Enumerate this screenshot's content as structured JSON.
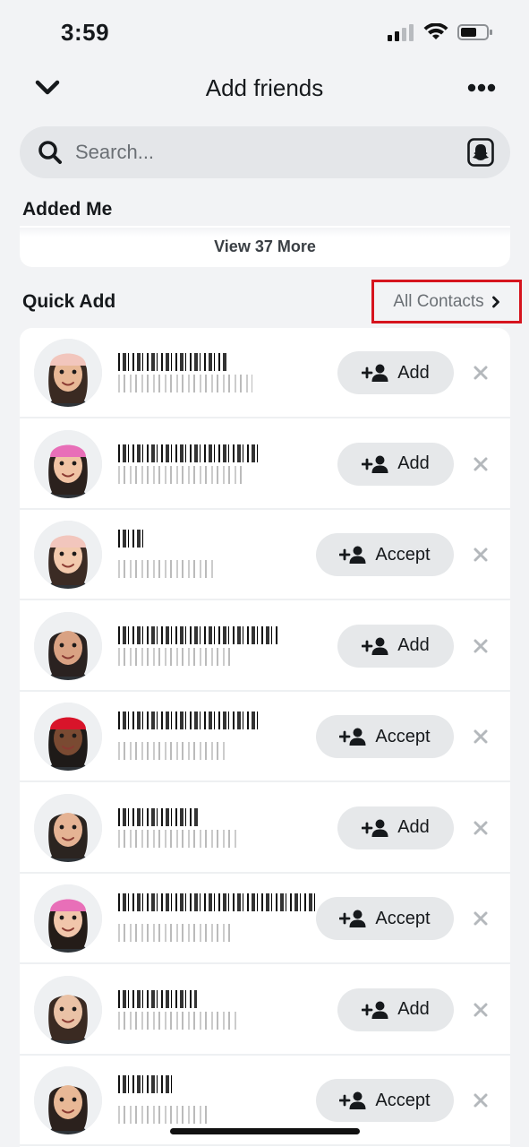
{
  "status": {
    "time": "3:59"
  },
  "header": {
    "title": "Add friends"
  },
  "search": {
    "placeholder": "Search..."
  },
  "added_me": {
    "title": "Added Me",
    "view_more": "View 37 More"
  },
  "quick_add": {
    "title": "Quick Add",
    "all_contacts": "All Contacts",
    "rows": [
      {
        "action": "add",
        "label": "Add",
        "skin": "#e8b896",
        "hair": "#3a2a22",
        "hat": "#f2c6bd"
      },
      {
        "action": "add",
        "label": "Add",
        "skin": "#f0c3a4",
        "hair": "#2b211d",
        "hat": "#e86fb8"
      },
      {
        "action": "accept",
        "label": "Accept",
        "skin": "#f2c9ad",
        "hair": "#3b2b24",
        "hat": "#f2c6bd"
      },
      {
        "action": "add",
        "label": "Add",
        "skin": "#d9a283",
        "hair": "#2a2220",
        "hat": ""
      },
      {
        "action": "accept",
        "label": "Accept",
        "skin": "#7a4a32",
        "hair": "#1e1a18",
        "hat": "#d8142a"
      },
      {
        "action": "add",
        "label": "Add",
        "skin": "#e5b394",
        "hair": "#2b2420",
        "hat": ""
      },
      {
        "action": "accept",
        "label": "Accept",
        "skin": "#f1c6ab",
        "hair": "#241c18",
        "hat": "#e86fb8"
      },
      {
        "action": "add",
        "label": "Add",
        "skin": "#eac2a6",
        "hair": "#3a2a22",
        "hat": ""
      },
      {
        "action": "accept",
        "label": "Accept",
        "skin": "#e8b896",
        "hair": "#2b211d",
        "hat": ""
      }
    ]
  }
}
